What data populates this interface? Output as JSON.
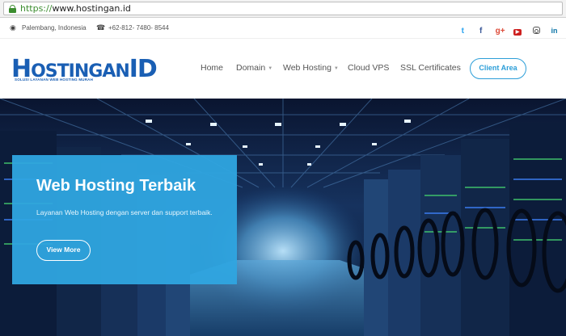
{
  "browser": {
    "url_scheme": "https://",
    "url_host": "www.hostingan.id",
    "secure_icon": "lock-icon"
  },
  "topbar": {
    "location_icon": "map-pin-icon",
    "location": "Palembang, Indonesia",
    "phone_icon": "phone-icon",
    "phone": "+62-812- 7480- 8544",
    "socials": [
      "twitter-icon",
      "facebook-icon",
      "google-plus-icon",
      "youtube-icon",
      "instagram-icon",
      "linkedin-icon"
    ]
  },
  "header": {
    "logo_text_h": "H",
    "logo_text_rest": "OSTINGAN",
    "logo_text_id": "ID",
    "logo_tagline": "SOLUSI LAYANAN WEB HOSTING MURAH",
    "nav": {
      "home": "Home",
      "domain": "Domain",
      "web_hosting": "Web Hosting",
      "cloud_vps": "Cloud VPS",
      "ssl": "SSL Certificates"
    },
    "client_area": "Client Area"
  },
  "hero": {
    "title": "Web Hosting Terbaik",
    "subtitle": "Layanan Web Hosting dengan server dan support terbaik.",
    "cta": "View More"
  },
  "colors": {
    "accent": "#2c9ed8",
    "panel": "#2fa5e0",
    "brand": "#1a5fb4",
    "url_green": "#3c8d2f"
  }
}
